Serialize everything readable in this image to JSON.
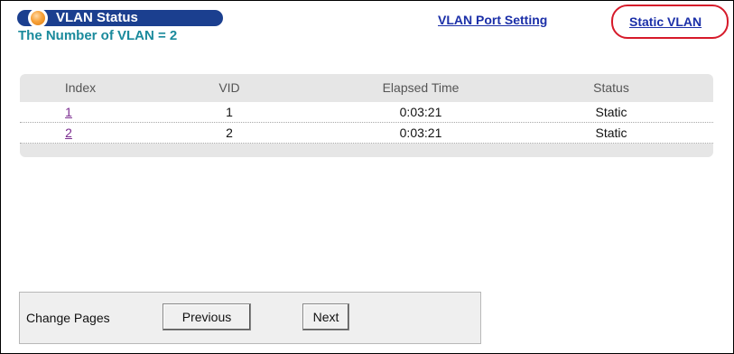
{
  "header": {
    "pill_title": "VLAN Status",
    "vlan_count_text": "The Number of VLAN = 2"
  },
  "links": {
    "vlan_port_setting": "VLAN Port Setting",
    "static_vlan": "Static VLAN"
  },
  "table": {
    "columns": [
      "Index",
      "VID",
      "Elapsed Time",
      "Status"
    ],
    "rows": [
      {
        "index": "1",
        "vid": "1",
        "elapsed": "0:03:21",
        "status": "Static"
      },
      {
        "index": "2",
        "vid": "2",
        "elapsed": "0:03:21",
        "status": "Static"
      }
    ]
  },
  "pager": {
    "label": "Change Pages",
    "previous": "Previous",
    "next": "Next"
  },
  "colors": {
    "pill_bg": "#1b3f8f",
    "count_text": "#1a8a9c",
    "link": "#1b2fa8",
    "highlight_ring": "#d61a2a",
    "index_link": "#7a2b8f"
  }
}
